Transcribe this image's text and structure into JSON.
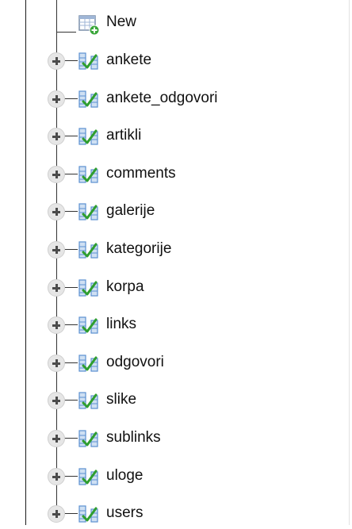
{
  "tree": {
    "new_item": {
      "label": "New",
      "icon": "new-table-icon"
    },
    "tables": [
      {
        "label": "ankete",
        "icon": "table-structure-icon"
      },
      {
        "label": "ankete_odgovori",
        "icon": "table-structure-icon"
      },
      {
        "label": "artikli",
        "icon": "table-structure-icon"
      },
      {
        "label": "comments",
        "icon": "table-structure-icon"
      },
      {
        "label": "galerije",
        "icon": "table-structure-icon"
      },
      {
        "label": "kategorije",
        "icon": "table-structure-icon"
      },
      {
        "label": "korpa",
        "icon": "table-structure-icon"
      },
      {
        "label": "links",
        "icon": "table-structure-icon"
      },
      {
        "label": "odgovori",
        "icon": "table-structure-icon"
      },
      {
        "label": "slike",
        "icon": "table-structure-icon"
      },
      {
        "label": "sublinks",
        "icon": "table-structure-icon"
      },
      {
        "label": "uloge",
        "icon": "table-structure-icon"
      },
      {
        "label": "users",
        "icon": "table-structure-icon"
      }
    ]
  },
  "colors": {
    "text": "#111111",
    "tree_line": "#333333",
    "expander_bg": "#e6e6e6",
    "icon_blue": "#5b8fd0",
    "icon_green": "#2f9e2f"
  }
}
